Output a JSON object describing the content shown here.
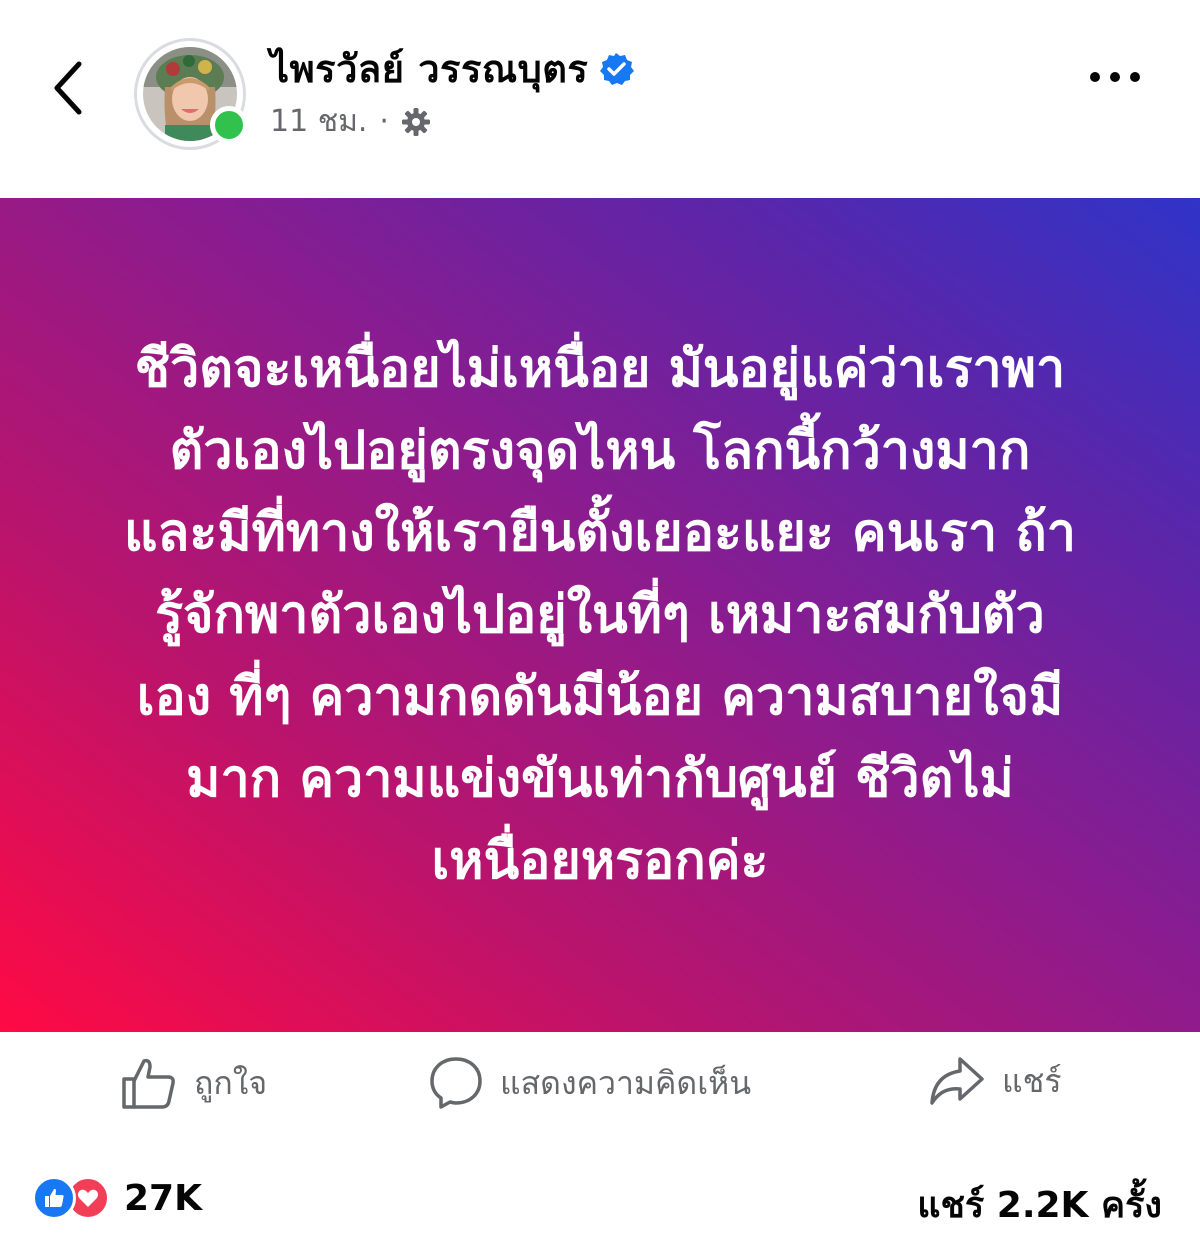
{
  "header": {
    "name": "ไพรวัลย์ วรรณบุตร",
    "time": "11 ชม.",
    "separator": "·"
  },
  "post": {
    "lines": [
      "ชีวิตจะเหนื่อยไม่เหนื่อย มันอยู่แค่ว่าเราพา",
      "ตัวเองไปอยู่ตรงจุดไหน โลกนี้กว้างมาก",
      "และมีที่ทางให้เรายืนตั้งเยอะแยะ คนเรา ถ้า",
      "รู้จักพาตัวเองไปอยู่ในที่ๆ เหมาะสมกับตัว",
      "เอง ที่ๆ ความกดดันมีน้อย ความสบายใจมี",
      "มาก ความแข่งขันเท่ากับศูนย์  ชีวิตไม่",
      "เหนื่อยหรอกค่ะ"
    ],
    "gradient": [
      "#ff0a44",
      "#8b1c8f",
      "#2f34c8"
    ]
  },
  "actions": {
    "like": "ถูกใจ",
    "comment": "แสดงความคิดเห็น",
    "share": "แชร์"
  },
  "stats": {
    "reactions_count": "27K",
    "shares": "แชร์ 2.2K ครั้ง"
  },
  "icons": [
    "back-icon",
    "verified-badge-icon",
    "gear-icon",
    "more-icon",
    "like-icon",
    "comment-icon",
    "share-icon",
    "like-reaction-icon",
    "love-reaction-icon"
  ],
  "colors": {
    "verified": "#1877f2",
    "online": "#31c24d",
    "like": "#1877f2",
    "love": "#f33e58",
    "secondary": "#65676b"
  }
}
